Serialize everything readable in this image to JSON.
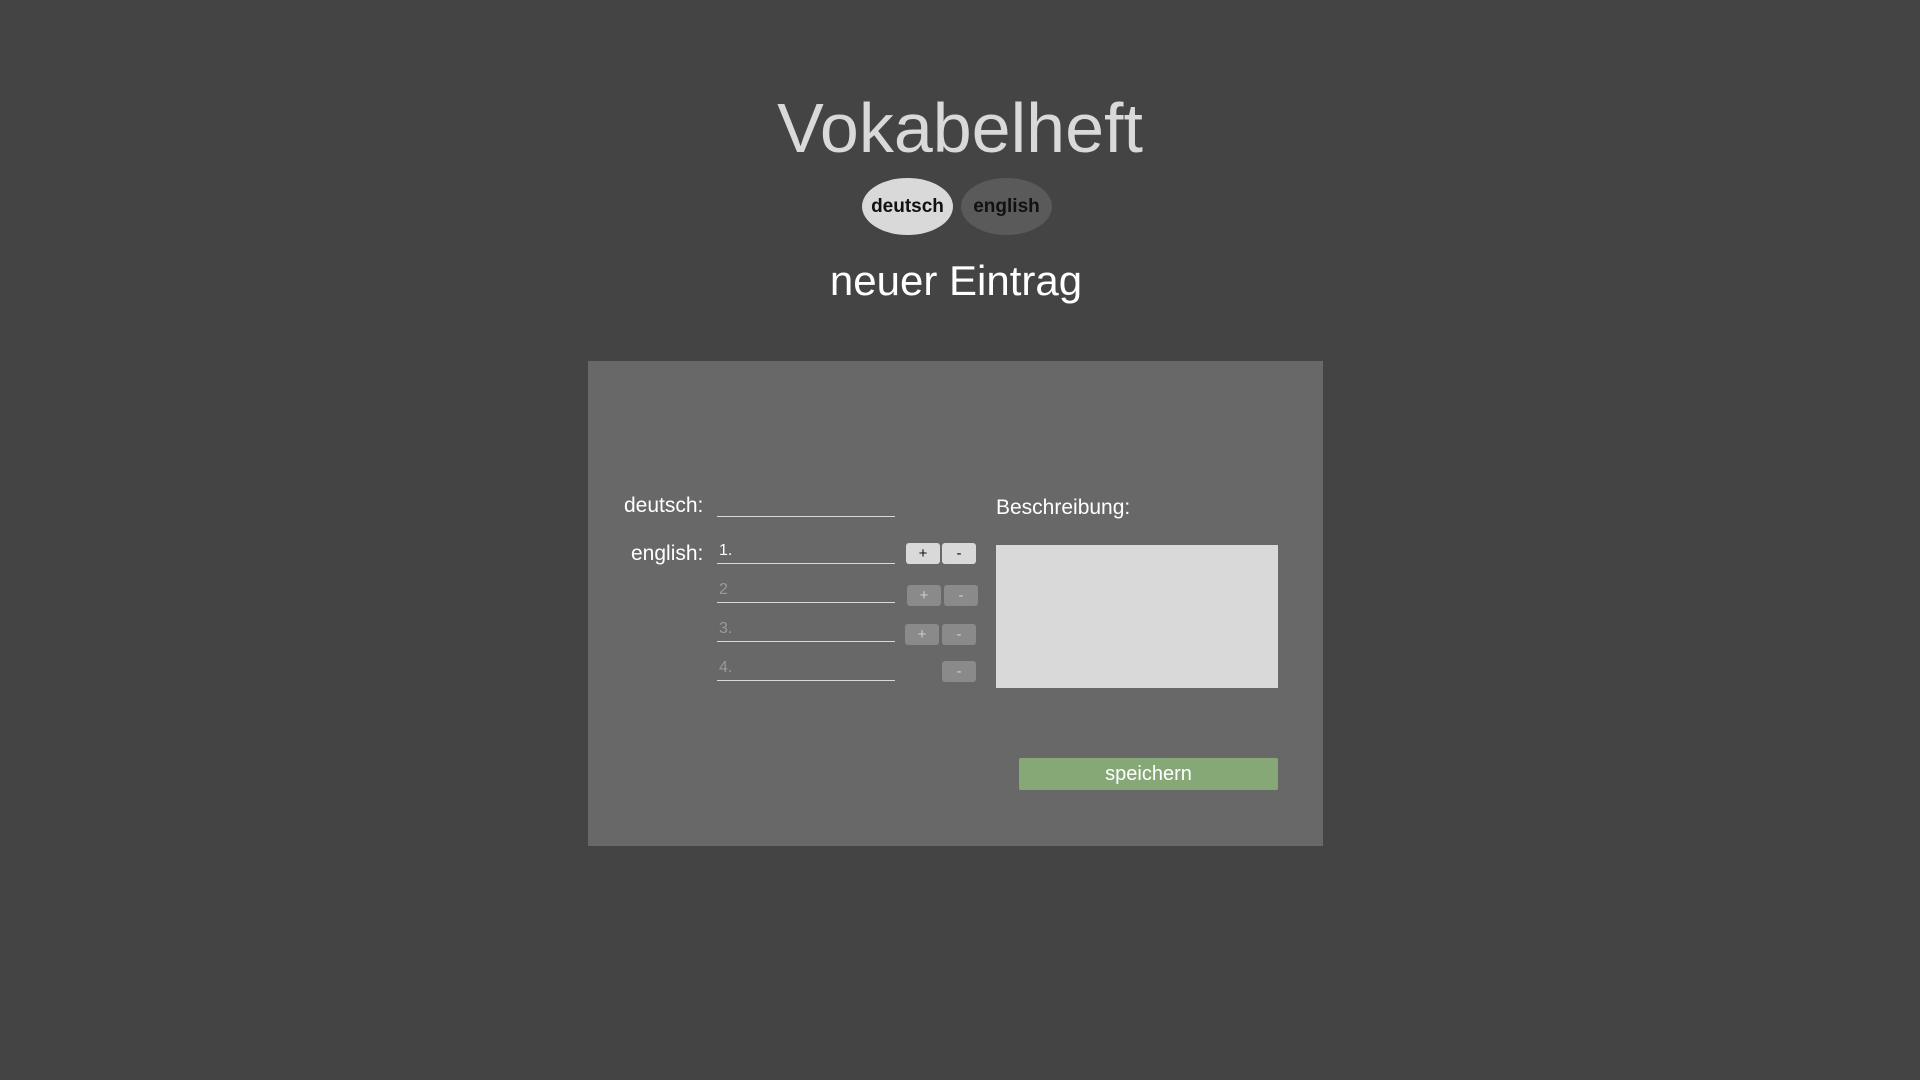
{
  "app": {
    "title": "Vokabelheft"
  },
  "language_switch": {
    "options": [
      {
        "label": "deutsch",
        "active": true
      },
      {
        "label": "english",
        "active": false
      }
    ]
  },
  "page": {
    "heading": "neuer Eintrag"
  },
  "form": {
    "german_label": "deutsch:",
    "german_value": "",
    "english_label": "english:",
    "english_fields": [
      {
        "placeholder": "1.",
        "add_label": "+",
        "remove_label": "-"
      },
      {
        "placeholder": "2",
        "add_label": "+",
        "remove_label": "-"
      },
      {
        "placeholder": "3.",
        "add_label": "+",
        "remove_label": "-"
      },
      {
        "placeholder": "4.",
        "remove_label": "-"
      }
    ],
    "description_label": "Beschreibung:",
    "description_value": "",
    "save_label": "speichern"
  },
  "colors": {
    "background": "#444444",
    "card": "#686868",
    "active_pill": "#d9d9d9",
    "inactive_pill": "#5a5a5a",
    "save_button": "#86a877"
  }
}
